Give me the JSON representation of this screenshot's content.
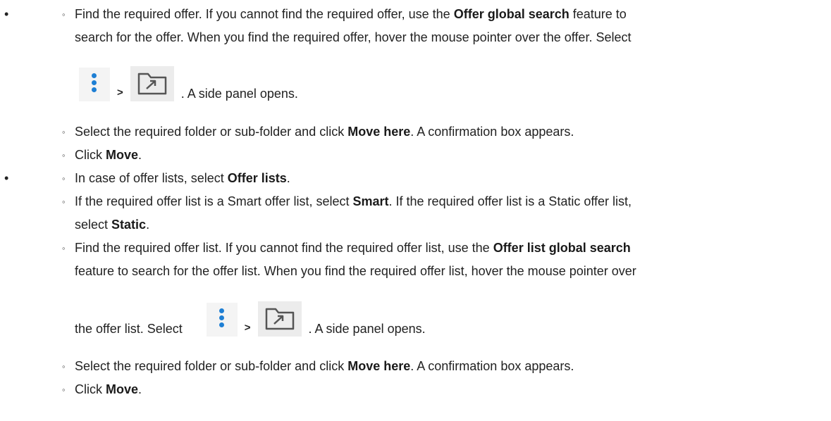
{
  "bullets": [
    "•",
    "•"
  ],
  "sub_marker": "◦",
  "a": {
    "step1_p1": "Find the required offer. If you cannot find the required offer, use the ",
    "step1_b1": "Offer global search",
    "step1_p2": " feature to",
    "step1_line2": "search for the offer. When you find the required offer, hover the mouse pointer over the offer. Select",
    "gt": ">",
    "step1_tail": ". A side panel opens.",
    "step2_p1": "Select the required folder or sub-folder and click ",
    "step2_b1": "Move here",
    "step2_p2": ". A confirmation box appears.",
    "step3_p1": "Click ",
    "step3_b1": "Move",
    "step3_p2": "."
  },
  "b": {
    "step1_p1": "In case of offer lists, select ",
    "step1_b1": "Offer lists",
    "step1_p2": ".",
    "step2_p1": "If the required offer list is a Smart offer list, select ",
    "step2_b1": "Smart",
    "step2_p2": ". If the required offer list is a Static offer list,",
    "step2_line2_p1": "select ",
    "step2_line2_b1": "Static",
    "step2_line2_p2": ".",
    "step3_p1": "Find the required offer list. If you cannot find the required offer list, use the ",
    "step3_b1": "Offer list global search",
    "step3_line2": "feature to search for the offer list. When you find the required offer list, hover the mouse pointer over",
    "step3_line3_p1": "the offer list. Select",
    "gt": ">",
    "step3_tail": ". A side panel opens.",
    "step4_p1": "Select the required folder or sub-folder and click ",
    "step4_b1": "Move here",
    "step4_p2": ". A confirmation box appears.",
    "step5_p1": "Click ",
    "step5_b1": "Move",
    "step5_p2": "."
  },
  "icons": {
    "kebab": "more-vertical-icon",
    "folder": "move-to-folder-icon"
  },
  "colors": {
    "kebab_dots": "#1e7fd4",
    "text": "#222222"
  }
}
